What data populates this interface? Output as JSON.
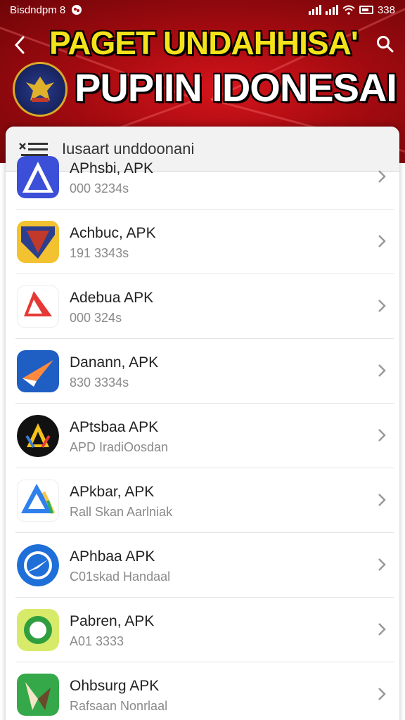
{
  "status_bar": {
    "left_text": "Bisdndpm 8",
    "time": "338",
    "icons": [
      "notification-icon",
      "signal-icon",
      "signal-icon",
      "wifi-icon",
      "battery-icon"
    ]
  },
  "header": {
    "title_line_1": "PAGET UNDAHHISA'",
    "title_line_2": "PUPIIN IDONESAI",
    "colors": {
      "background": "#c4111a",
      "title_1": "#f4e21a",
      "title_2": "#ffffff"
    }
  },
  "list": {
    "header_label": "Iusaart unddoonani",
    "items": [
      {
        "name": "APhsbi, APK",
        "sub": "000 3234s",
        "icon": "app-icon-a-blue"
      },
      {
        "name": "Achbuc, APK",
        "sub": "191 3343s",
        "icon": "app-icon-emblem"
      },
      {
        "name": "Adebua APK",
        "sub": "000 324s",
        "icon": "app-icon-a-red"
      },
      {
        "name": "Danann, APK",
        "sub": "830 3334s",
        "icon": "app-icon-plane"
      },
      {
        "name": "APtsbaa APK",
        "sub": "APD IradiOosdan",
        "icon": "app-icon-a-yellow"
      },
      {
        "name": "APkbar, APK",
        "sub": "Rall Skan Aarlniak",
        "icon": "app-icon-a-gradient"
      },
      {
        "name": "APhbaa APK",
        "sub": "C01skad Handaal",
        "icon": "app-icon-compass"
      },
      {
        "name": "Pabren, APK",
        "sub": "A01 3333",
        "icon": "app-icon-green-circle"
      },
      {
        "name": "Ohbsurg APK",
        "sub": "Rafsaan Nonrlaal",
        "icon": "app-icon-green-bird"
      }
    ]
  }
}
